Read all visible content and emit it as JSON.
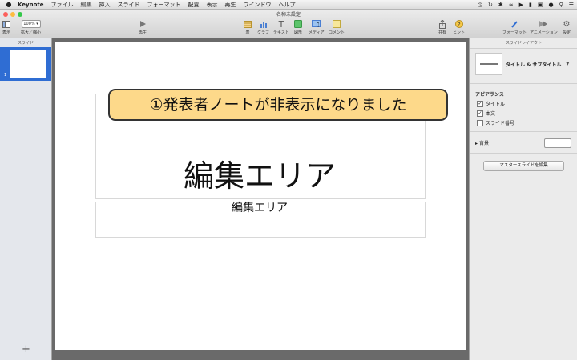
{
  "menubar": {
    "app_name": "Keynote",
    "items": [
      "ファイル",
      "編集",
      "挿入",
      "スライド",
      "フォーマット",
      "配置",
      "表示",
      "再生",
      "ウインドウ",
      "ヘルプ"
    ]
  },
  "window": {
    "title": "名称未設定"
  },
  "toolbar": {
    "view_label": "表示",
    "zoom_value": "100%",
    "zoom_label": "拡大／縮小",
    "play_label": "再生",
    "table_label": "表",
    "chart_label": "グラフ",
    "text_label": "テキスト",
    "shape_label": "図形",
    "media_label": "メディア",
    "comment_label": "コメント",
    "share_label": "共有",
    "tips_label": "ヒント",
    "format_label": "フォーマット",
    "animate_label": "アニメーション",
    "document_label": "設定"
  },
  "navigator": {
    "header": "スライド",
    "slide_number": "1",
    "add": "+"
  },
  "slide": {
    "title_text": "編集エリア",
    "body_text": "編集エリア"
  },
  "callout": {
    "text": "①発表者ノートが非表示になりました"
  },
  "inspector": {
    "header": "スライドレイアウト",
    "layout_name": "タイトル & サブタイトル",
    "appearance_title": "アピアランス",
    "checkbox_title": "タイトル",
    "checkbox_body": "本文",
    "checkbox_slide_number": "スライド番号",
    "background_label": "背景",
    "edit_master_button": "マスタースライドを編集"
  },
  "colors": {
    "accent": "#2f6dd3",
    "callout_fill": "#fdd98a"
  }
}
